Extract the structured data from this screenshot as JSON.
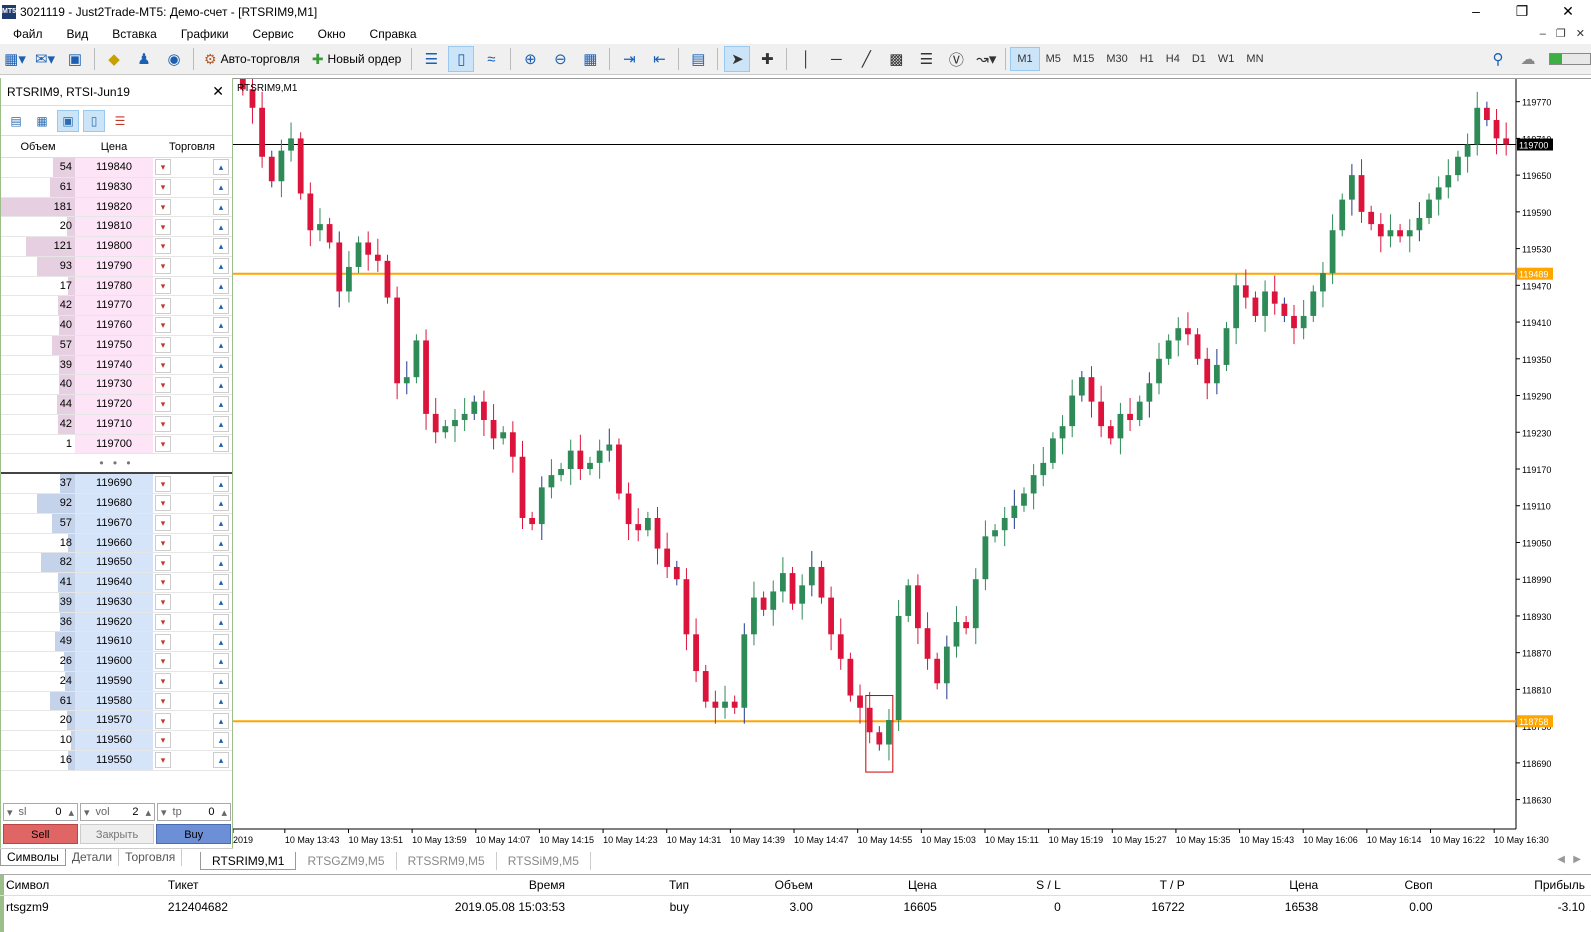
{
  "window": {
    "title": "3021119 - Just2Trade-MT5: Демо-счет - [RTSRIM9,M1]",
    "app_icon": "MT5"
  },
  "menu": [
    "Файл",
    "Вид",
    "Вставка",
    "Графики",
    "Сервис",
    "Окно",
    "Справка"
  ],
  "toolbar": {
    "autotrading_label": "Авто-торговля",
    "new_order_label": "Новый ордер",
    "timeframes": [
      "M1",
      "M5",
      "M15",
      "M30",
      "H1",
      "H4",
      "D1",
      "W1",
      "MN"
    ],
    "active_timeframe": "M1"
  },
  "depth": {
    "title": "RTSRIM9, RTSI-Jun19",
    "col_volume": "Объем",
    "col_price": "Цена",
    "col_trade": "Торговля",
    "asks": [
      {
        "v": "54",
        "p": "119840"
      },
      {
        "v": "61",
        "p": "119830"
      },
      {
        "v": "181",
        "p": "119820"
      },
      {
        "v": "20",
        "p": "119810"
      },
      {
        "v": "121",
        "p": "119800"
      },
      {
        "v": "93",
        "p": "119790"
      },
      {
        "v": "17",
        "p": "119780"
      },
      {
        "v": "42",
        "p": "119770"
      },
      {
        "v": "40",
        "p": "119760"
      },
      {
        "v": "57",
        "p": "119750"
      },
      {
        "v": "39",
        "p": "119740"
      },
      {
        "v": "40",
        "p": "119730"
      },
      {
        "v": "44",
        "p": "119720"
      },
      {
        "v": "42",
        "p": "119710"
      },
      {
        "v": "1",
        "p": "119700"
      }
    ],
    "separator": "• • •",
    "bids": [
      {
        "v": "37",
        "p": "119690"
      },
      {
        "v": "92",
        "p": "119680"
      },
      {
        "v": "57",
        "p": "119670"
      },
      {
        "v": "18",
        "p": "119660"
      },
      {
        "v": "82",
        "p": "119650"
      },
      {
        "v": "41",
        "p": "119640"
      },
      {
        "v": "39",
        "p": "119630"
      },
      {
        "v": "36",
        "p": "119620"
      },
      {
        "v": "49",
        "p": "119610"
      },
      {
        "v": "26",
        "p": "119600"
      },
      {
        "v": "24",
        "p": "119590"
      },
      {
        "v": "61",
        "p": "119580"
      },
      {
        "v": "20",
        "p": "119570"
      },
      {
        "v": "10",
        "p": "119560"
      },
      {
        "v": "16",
        "p": "119550"
      }
    ],
    "sl_label": "sl",
    "sl_value": "0",
    "vol_label": "vol",
    "vol_value": "2",
    "tp_label": "tp",
    "tp_value": "0",
    "sell_label": "Sell",
    "close_label": "Закрыть",
    "buy_label": "Buy"
  },
  "left_tabs": [
    "Символы",
    "Детали",
    "Торговля"
  ],
  "chart_tabs": [
    "RTSRIM9,M1",
    "RTSGZM9,M5",
    "RTSSRM9,M5",
    "RTSSiM9,M5"
  ],
  "chart_data": {
    "type": "candlestick",
    "title": "RTSRIM9,M1",
    "y_ticks": [
      119770,
      119710,
      119650,
      119590,
      119530,
      119470,
      119410,
      119350,
      119290,
      119230,
      119170,
      119110,
      119050,
      118990,
      118930,
      118870,
      118810,
      118750,
      118690,
      118630
    ],
    "ylim": [
      118582,
      119807
    ],
    "current_price": "119700",
    "level_high": "119489",
    "level_low": "118758",
    "x_labels": [
      "2019",
      "10 May 13:43",
      "10 May 13:51",
      "10 May 13:59",
      "10 May 14:07",
      "10 May 14:15",
      "10 May 14:23",
      "10 May 14:31",
      "10 May 14:39",
      "10 May 14:47",
      "10 May 14:55",
      "10 May 15:03",
      "10 May 15:11",
      "10 May 15:19",
      "10 May 15:27",
      "10 May 15:35",
      "10 May 15:43",
      "10 May 16:06",
      "10 May 16:14",
      "10 May 16:22",
      "10 May 16:30"
    ],
    "colors": {
      "up": "#2e8b57",
      "down": "#dc143c",
      "level": "#ffa500",
      "bid_line": "#000000"
    },
    "closes": [
      119790,
      119760,
      119680,
      119640,
      119690,
      119710,
      119620,
      119560,
      119570,
      119540,
      119460,
      119500,
      119540,
      119520,
      119510,
      119450,
      119310,
      119320,
      119380,
      119260,
      119230,
      119240,
      119250,
      119260,
      119280,
      119250,
      119220,
      119230,
      119190,
      119090,
      119080,
      119140,
      119160,
      119170,
      119200,
      119170,
      119180,
      119200,
      119210,
      119130,
      119080,
      119070,
      119090,
      119040,
      119010,
      118990,
      118900,
      118840,
      118790,
      118780,
      118790,
      118780,
      118900,
      118960,
      118940,
      118970,
      119000,
      118950,
      118980,
      119010,
      118960,
      118900,
      118860,
      118800,
      118780,
      118740,
      118720,
      118760,
      118930,
      118980,
      118910,
      118860,
      118820,
      118880,
      118920,
      118910,
      118990,
      119060,
      119070,
      119090,
      119110,
      119130,
      119160,
      119180,
      119220,
      119240,
      119290,
      119320,
      119280,
      119240,
      119220,
      119260,
      119250,
      119280,
      119310,
      119350,
      119380,
      119400,
      119390,
      119350,
      119310,
      119340,
      119400,
      119470,
      119450,
      119420,
      119460,
      119440,
      119420,
      119400,
      119420,
      119460,
      119490,
      119560,
      119610,
      119650,
      119590,
      119570,
      119550,
      119560,
      119550,
      119560,
      119580,
      119610,
      119630,
      119650,
      119680,
      119700,
      119760,
      119740,
      119710,
      119700
    ]
  },
  "positions": {
    "headers": [
      "Символ",
      "Тикет",
      "Время",
      "Тип",
      "Объем",
      "Цена",
      "S / L",
      "T / P",
      "Цена",
      "Своп",
      "Прибыль"
    ],
    "rows": [
      [
        "rtsgzm9",
        "212404682",
        "2019.05.08 15:03:53",
        "buy",
        "3.00",
        "16605",
        "0",
        "16722",
        "16538",
        "0.00",
        "-3.10"
      ]
    ]
  }
}
